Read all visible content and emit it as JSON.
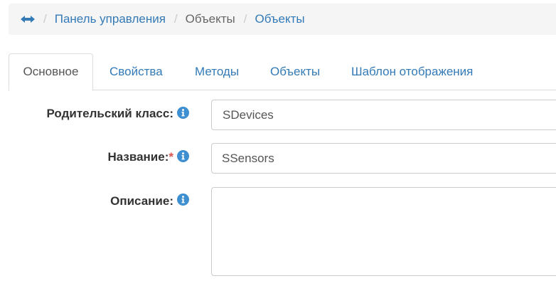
{
  "breadcrumb": {
    "toggle_icon": "left-right-arrow-icon",
    "separator": "/",
    "items": [
      {
        "label": "Панель управления",
        "link": true
      },
      {
        "label": "Объекты",
        "link": false
      },
      {
        "label": "Объекты",
        "link": true
      }
    ]
  },
  "tabs": [
    {
      "label": "Основное",
      "active": true
    },
    {
      "label": "Свойства",
      "active": false
    },
    {
      "label": "Методы",
      "active": false
    },
    {
      "label": "Объекты",
      "active": false
    },
    {
      "label": "Шаблон отображения",
      "active": false
    }
  ],
  "form": {
    "parent_class": {
      "label": "Родительский класс:",
      "value": "SDevices",
      "info_icon": "info-icon"
    },
    "name": {
      "label": "Название:",
      "required_mark": "*",
      "value": "SSensors",
      "info_icon": "info-icon"
    },
    "description": {
      "label": "Описание:",
      "value": "",
      "info_icon": "info-icon"
    }
  },
  "colors": {
    "link": "#337ab7",
    "required": "#d9534f",
    "info_icon": "#3d8fd1",
    "breadcrumb_bg": "#f5f5f5"
  }
}
